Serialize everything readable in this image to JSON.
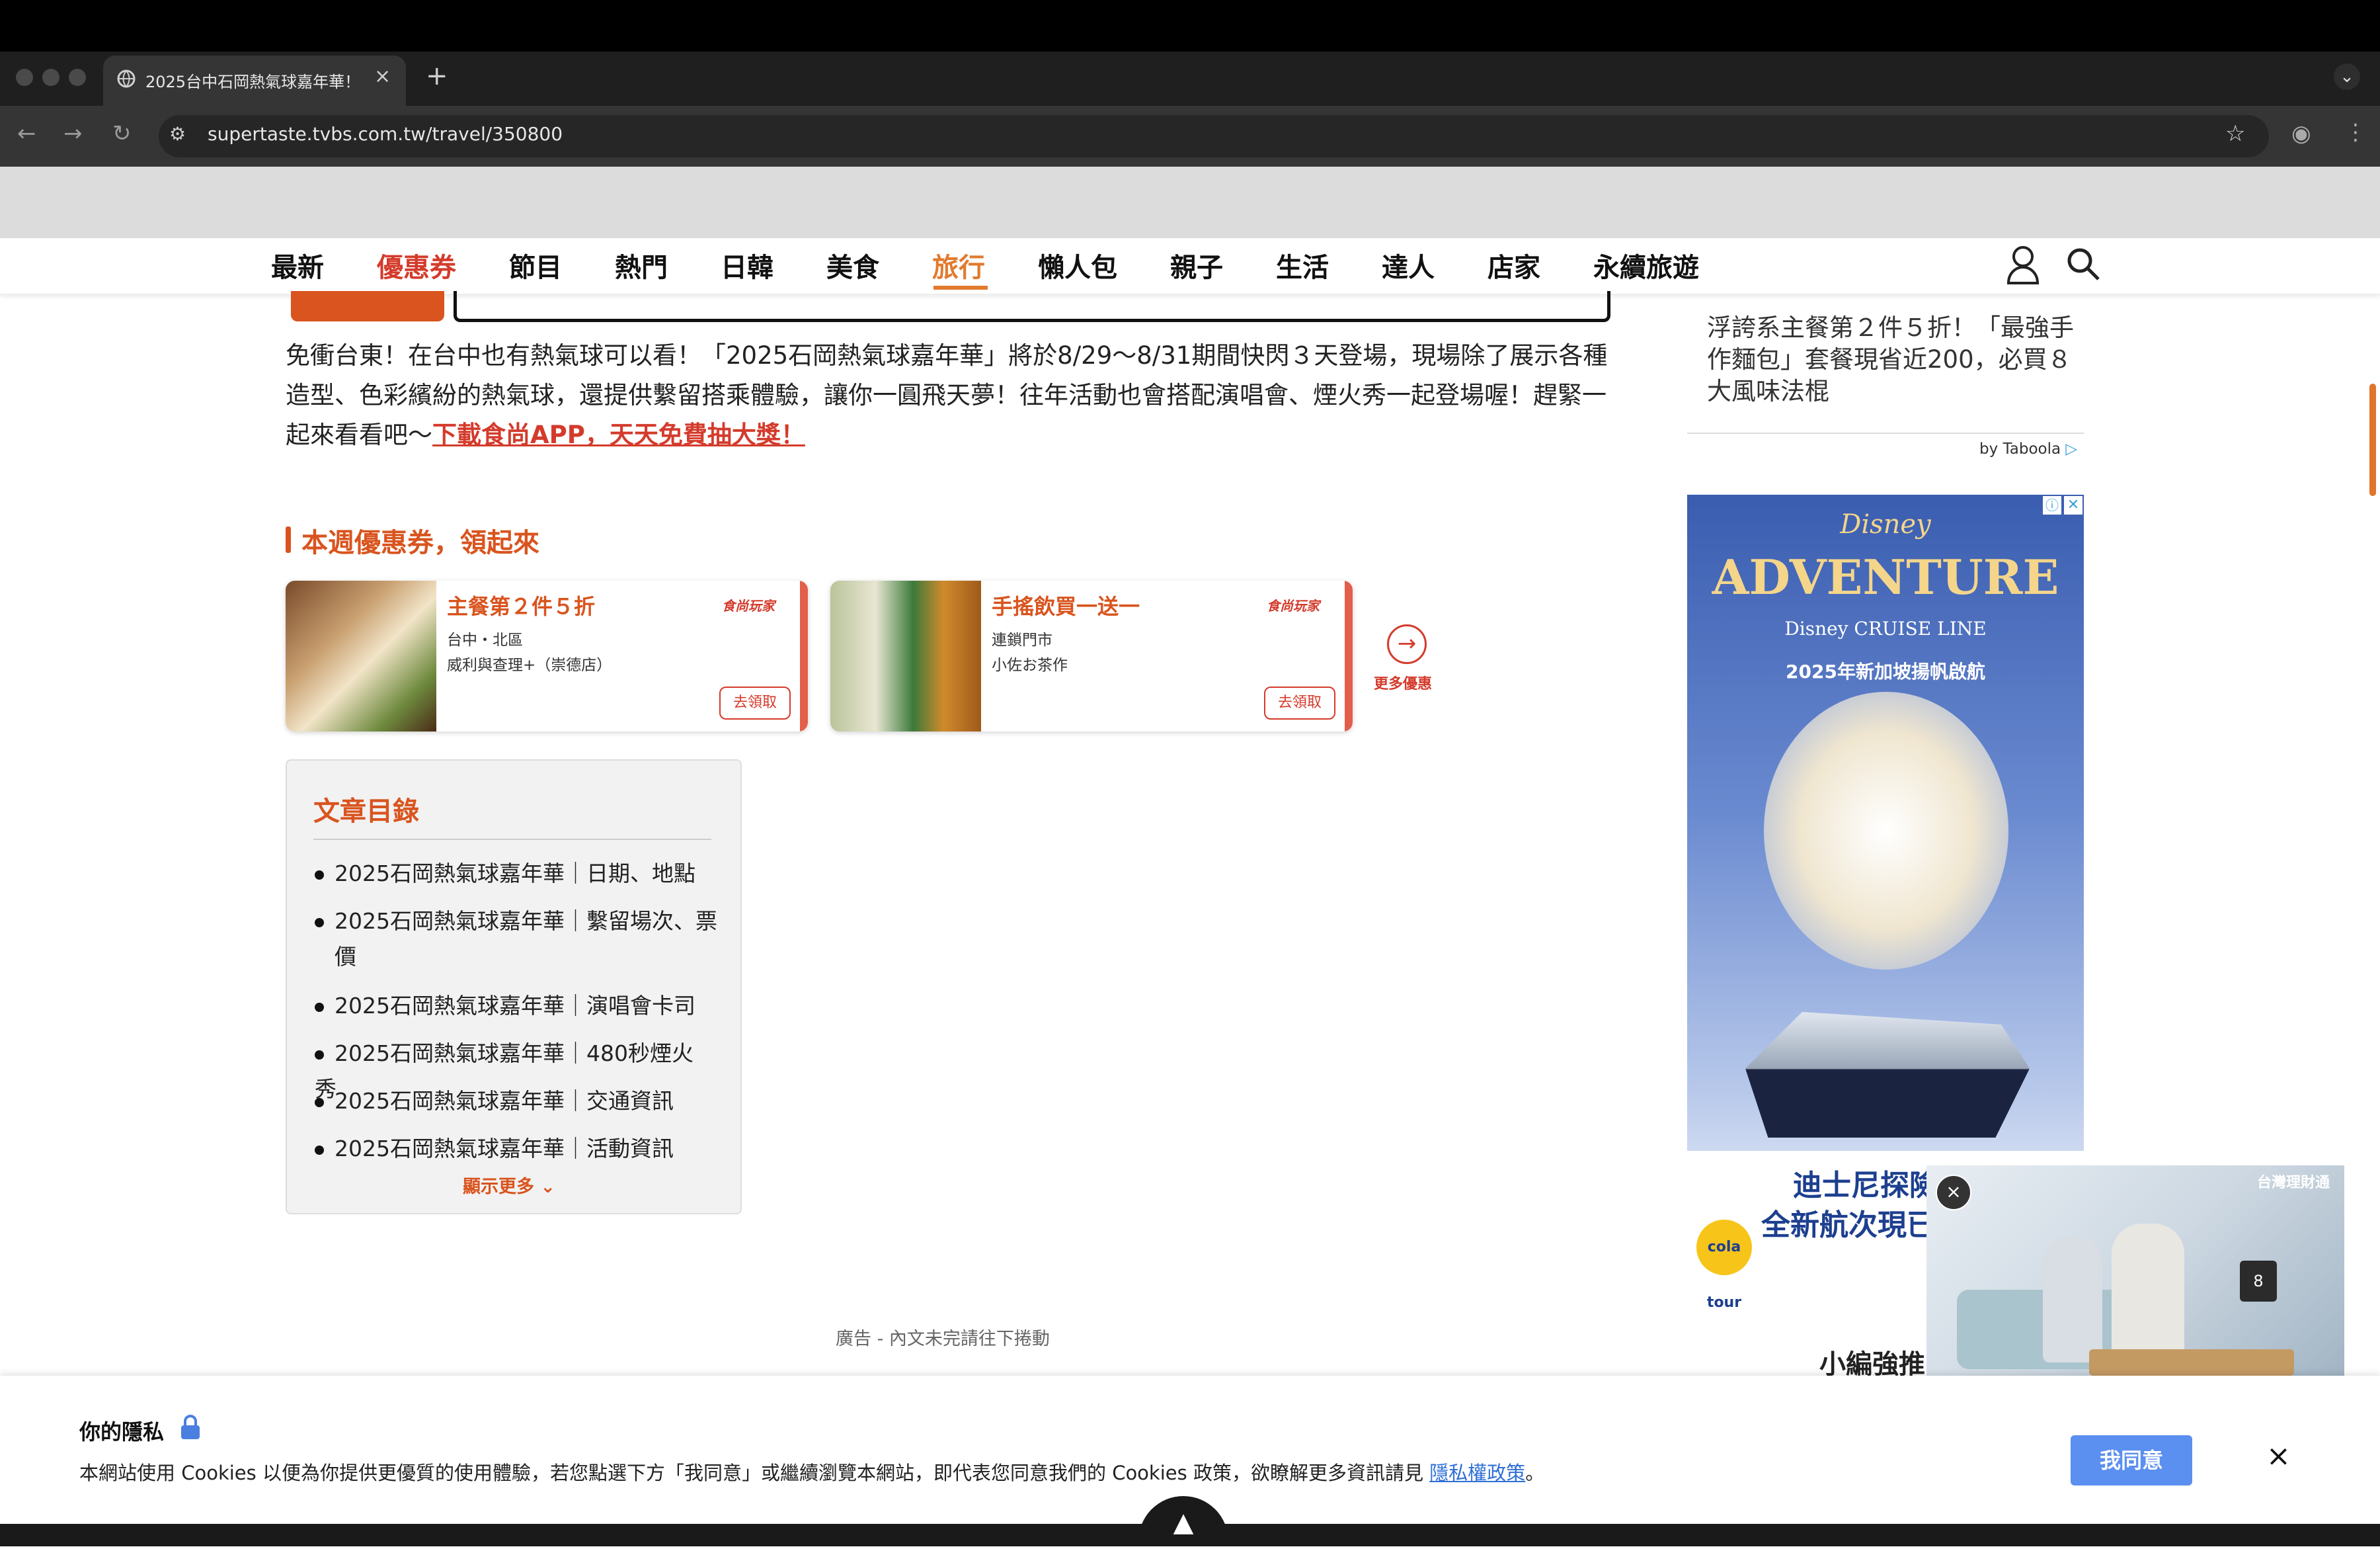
{
  "browser": {
    "tab_title": "2025台中石岡熱氣球嘉年華！",
    "tab_close": "×",
    "new_tab": "+",
    "url": "supertaste.tvbs.com.tw/travel/350800"
  },
  "site_nav": {
    "items": [
      "最新",
      "優惠券",
      "節目",
      "熱門",
      "日韓",
      "美食",
      "旅行",
      "懶人包",
      "親子",
      "生活",
      "達人",
      "店家",
      "永續旅遊"
    ],
    "active": "旅行",
    "highlight": "優惠券",
    "colors": {
      "red": "#d43b2c",
      "orange": "#e27a2e"
    }
  },
  "article": {
    "intro": "免衝台東！在台中也有熱氣球可以看！「2025石岡熱氣球嘉年華」將於8/29～8/31期間快閃３天登場，現場除了展示各種造型、色彩繽紛的熱氣球，還提供繫留搭乘體驗，讓你一圓飛天夢！往年活動也會搭配演唱會、煙火秀一起登場喔！趕緊一起來看看吧～",
    "intro_link": "下載食尚APP，天天免費抽大獎！",
    "coupon_heading": "本週優惠券，領起來",
    "coupons": [
      {
        "title": "主餐第２件５折",
        "line1": "台中・北區",
        "line2": "威利與查理+（崇德店）",
        "logo": "食尚玩家",
        "claim": "去領取"
      },
      {
        "title": "手搖飲買一送一",
        "line1": "連鎖門市",
        "line2": "小佐お茶作",
        "logo": "食尚玩家",
        "claim": "去領取"
      }
    ],
    "more_coupons": "更多優惠",
    "toc": {
      "title": "文章目錄",
      "items": [
        "2025石岡熱氣球嘉年華｜日期、地點",
        "2025石岡熱氣球嘉年華｜繫留場次、票價",
        "2025石岡熱氣球嘉年華｜演唱會卡司",
        "2025石岡熱氣球嘉年華｜480秒煙火秀",
        "2025石岡熱氣球嘉年華｜交通資訊",
        "2025石岡熱氣球嘉年華｜活動資訊"
      ],
      "more": "顯示更多"
    },
    "ad_note": "廣告 - 內文未完請往下捲動"
  },
  "sidebar": {
    "story": "浮誇系主餐第２件５折！「最強手作麵包」套餐現省近200，必買８大風味法棍",
    "taboola": "by Taboola",
    "ad": {
      "brand": "Disney",
      "title": "ADVENTURE",
      "subtitle": "Disney CRUISE LINE",
      "tagline": "2025年新加坡揚帆啟航",
      "line1": "迪士尼探險",
      "line2": "全新航次現已",
      "badge": "cola tour"
    },
    "editor_pick": "小編強推"
  },
  "video": {
    "brand": "台灣理財通",
    "count": "8",
    "close": "×"
  },
  "cookie": {
    "title": "你的隱私",
    "text": "本網站使用 Cookies 以便為你提供更優質的使用體驗，若您點選下方「我同意」或繼續瀏覽本網站，即代表您同意我們的 Cookies 政策，欲瞭解更多資訊請見 ",
    "link": "隱私權政策",
    "period": "。",
    "agree": "我同意",
    "close": "×"
  }
}
